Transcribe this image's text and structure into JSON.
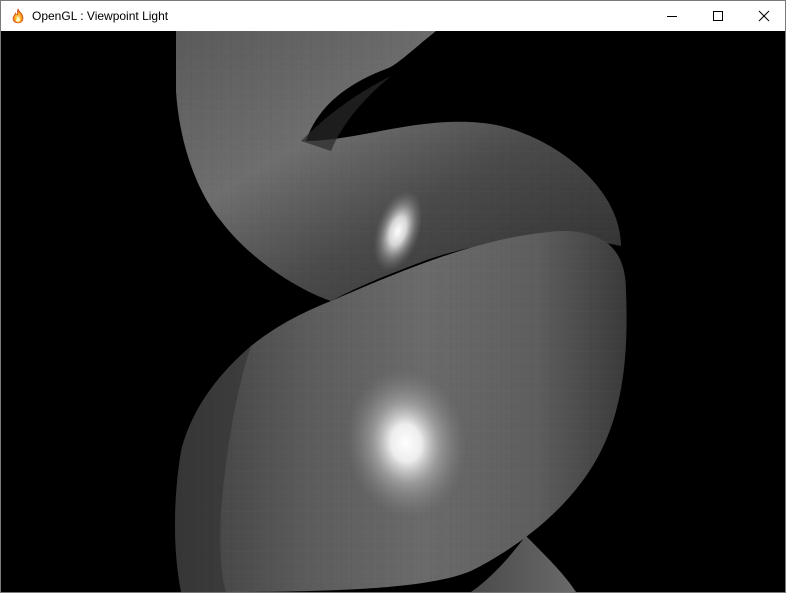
{
  "window": {
    "title": "OpenGL : Viewpoint Light",
    "icon": "flame-icon",
    "controls": [
      "minimize-icon",
      "maximize-icon",
      "close-icon"
    ]
  },
  "viewport": {
    "background": "#000000",
    "scene": "shaded-helix",
    "surface_color": "#7a7a7a",
    "specular_color": "#ffffff"
  }
}
